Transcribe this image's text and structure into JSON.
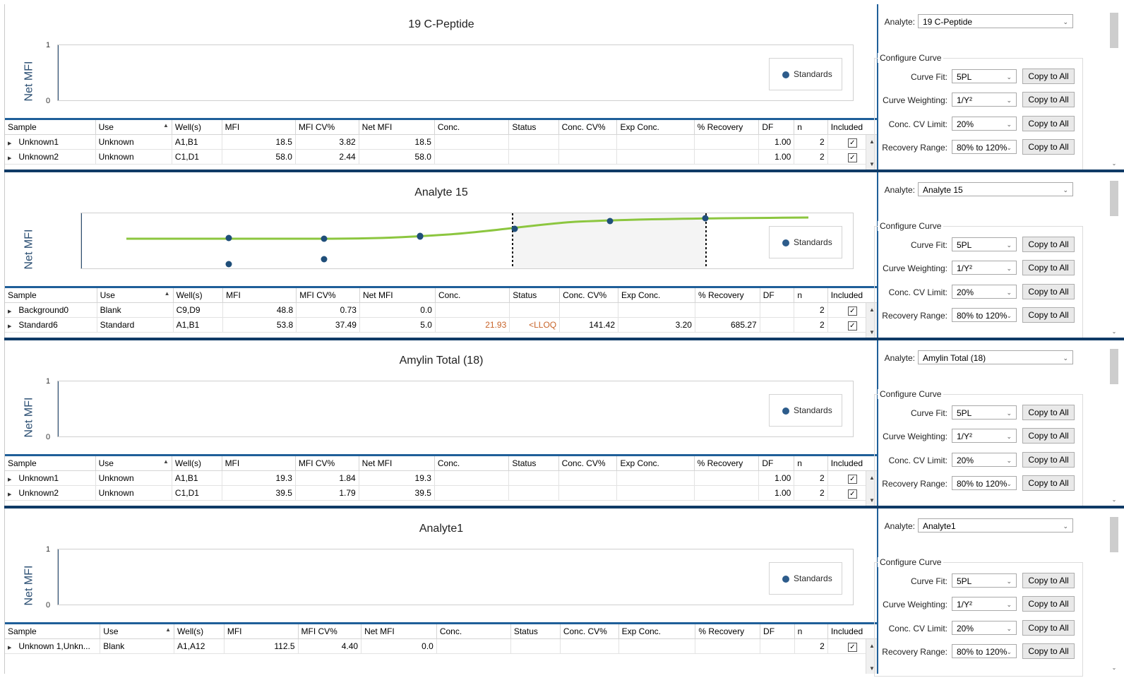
{
  "columns": [
    "Sample",
    "Use",
    "Well(s)",
    "MFI",
    "MFI CV%",
    "Net MFI",
    "Conc.",
    "Status",
    "Conc. CV%",
    "Exp Conc.",
    "% Recovery",
    "DF",
    "n",
    "Included"
  ],
  "sort_indicator": "▲",
  "legend_label": "Standards",
  "y_axis_label": "Net MFI",
  "config": {
    "analyte_label": "Analyte:",
    "group_title": "Configure Curve",
    "curve_fit_label": "Curve Fit:",
    "curve_fit_value": "5PL",
    "weighting_label": "Curve Weighting:",
    "weighting_value": "1/Y²",
    "cv_limit_label": "Conc. CV Limit:",
    "cv_limit_value": "20%",
    "recovery_label": "Recovery Range:",
    "recovery_value": "80% to 120%",
    "copy_label": "Copy to All"
  },
  "colors": {
    "accent": "#1f5f99",
    "separator": "#0f3a66",
    "curve": "#8cc63f",
    "point": "#1f4e79",
    "warning": "#c8642a"
  },
  "panels": [
    {
      "title": "19 C-Peptide",
      "analyte": "19 C-Peptide",
      "y_ticks": [
        "1",
        "0"
      ],
      "rows": [
        {
          "sample": "Unknown1",
          "use": "Unknown",
          "wells": "A1,B1",
          "mfi": "18.5",
          "mfi_cv": "3.82",
          "net_mfi": "18.5",
          "conc": "",
          "status": "",
          "conc_cv": "",
          "exp_conc": "",
          "recovery": "",
          "df": "1.00",
          "n": "2"
        },
        {
          "sample": "Unknown2",
          "use": "Unknown",
          "wells": "C1,D1",
          "mfi": "58.0",
          "mfi_cv": "2.44",
          "net_mfi": "58.0",
          "conc": "",
          "status": "",
          "conc_cv": "",
          "exp_conc": "",
          "recovery": "",
          "df": "1.00",
          "n": "2"
        }
      ]
    },
    {
      "title": "Analyte 15",
      "analyte": "Analyte 15",
      "y_ticks": [],
      "rows": [
        {
          "sample": "Background0",
          "use": "Blank",
          "wells": "C9,D9",
          "mfi": "48.8",
          "mfi_cv": "0.73",
          "net_mfi": "0.0",
          "conc": "",
          "status": "",
          "conc_cv": "",
          "exp_conc": "",
          "recovery": "",
          "df": "",
          "n": "2"
        },
        {
          "sample": "Standard6",
          "use": "Standard",
          "wells": "A1,B1",
          "mfi": "53.8",
          "mfi_cv": "37.49",
          "net_mfi": "5.0",
          "conc": "21.93",
          "status": "<LLOQ",
          "conc_cv": "141.42",
          "exp_conc": "3.20",
          "recovery": "685.27",
          "df": "",
          "n": "2"
        }
      ]
    },
    {
      "title": "Amylin Total (18)",
      "analyte": "Amylin Total (18)",
      "y_ticks": [
        "1",
        "0"
      ],
      "rows": [
        {
          "sample": "Unknown1",
          "use": "Unknown",
          "wells": "A1,B1",
          "mfi": "19.3",
          "mfi_cv": "1.84",
          "net_mfi": "19.3",
          "conc": "",
          "status": "",
          "conc_cv": "",
          "exp_conc": "",
          "recovery": "",
          "df": "1.00",
          "n": "2"
        },
        {
          "sample": "Unknown2",
          "use": "Unknown",
          "wells": "C1,D1",
          "mfi": "39.5",
          "mfi_cv": "1.79",
          "net_mfi": "39.5",
          "conc": "",
          "status": "",
          "conc_cv": "",
          "exp_conc": "",
          "recovery": "",
          "df": "1.00",
          "n": "2"
        }
      ]
    },
    {
      "title": "Analyte1",
      "analyte": "Analyte1",
      "y_ticks": [
        "1",
        "0"
      ],
      "rows": [
        {
          "sample": "Unknown 1,Unkn...",
          "use": "Blank",
          "wells": "A1,A12",
          "mfi": "112.5",
          "mfi_cv": "4.40",
          "net_mfi": "0.0",
          "conc": "",
          "status": "",
          "conc_cv": "",
          "exp_conc": "",
          "recovery": "",
          "df": "",
          "n": "2"
        }
      ]
    }
  ]
}
